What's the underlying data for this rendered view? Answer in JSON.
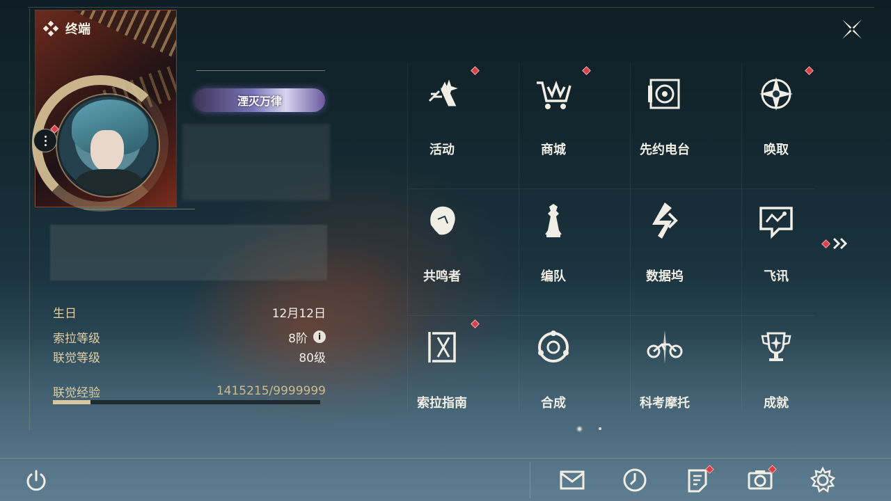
{
  "header": {
    "title": "终端"
  },
  "profile": {
    "title_badge": "湮灭万律",
    "stats": [
      {
        "label": "生日",
        "value": "12月12日"
      },
      {
        "label": "索拉等级",
        "value": "8阶"
      },
      {
        "label": "联觉等级",
        "value": "80级"
      }
    ],
    "xp": {
      "label": "联觉经验",
      "value": "1415215/9999999",
      "current": 1415215,
      "max": 9999999
    }
  },
  "menu": {
    "items": [
      {
        "label": "活动",
        "icon": "activity-icon",
        "badge": true
      },
      {
        "label": "商城",
        "icon": "shop-cart-icon",
        "badge": true
      },
      {
        "label": "先约电台",
        "icon": "radio-icon",
        "badge": false
      },
      {
        "label": "唤取",
        "icon": "convene-star-icon",
        "badge": true
      },
      {
        "label": "共鸣者",
        "icon": "resonator-head-icon",
        "badge": false
      },
      {
        "label": "编队",
        "icon": "chess-pieces-icon",
        "badge": false
      },
      {
        "label": "数据坞",
        "icon": "data-bank-icon",
        "badge": false
      },
      {
        "label": "飞讯",
        "icon": "chat-bubble-icon",
        "badge": false
      },
      {
        "label": "索拉指南",
        "icon": "guidebook-icon",
        "badge": true
      },
      {
        "label": "合成",
        "icon": "synthesis-icon",
        "badge": false
      },
      {
        "label": "科考摩托",
        "icon": "motorcycle-icon",
        "badge": false
      },
      {
        "label": "成就",
        "icon": "trophy-icon",
        "badge": false
      }
    ],
    "page_current": 1,
    "page_total": 2
  },
  "bottom_bar": {
    "buttons": [
      {
        "icon": "mail-icon",
        "badge": false
      },
      {
        "icon": "clock-icon",
        "badge": false
      },
      {
        "icon": "notice-icon",
        "badge": true
      },
      {
        "icon": "camera-icon",
        "badge": true
      },
      {
        "icon": "settings-gear-icon",
        "badge": false
      }
    ]
  },
  "colors": {
    "accent_gold": "#d8c79c",
    "badge_red": "#d4424e",
    "label_gold": "#e0cfa6"
  }
}
